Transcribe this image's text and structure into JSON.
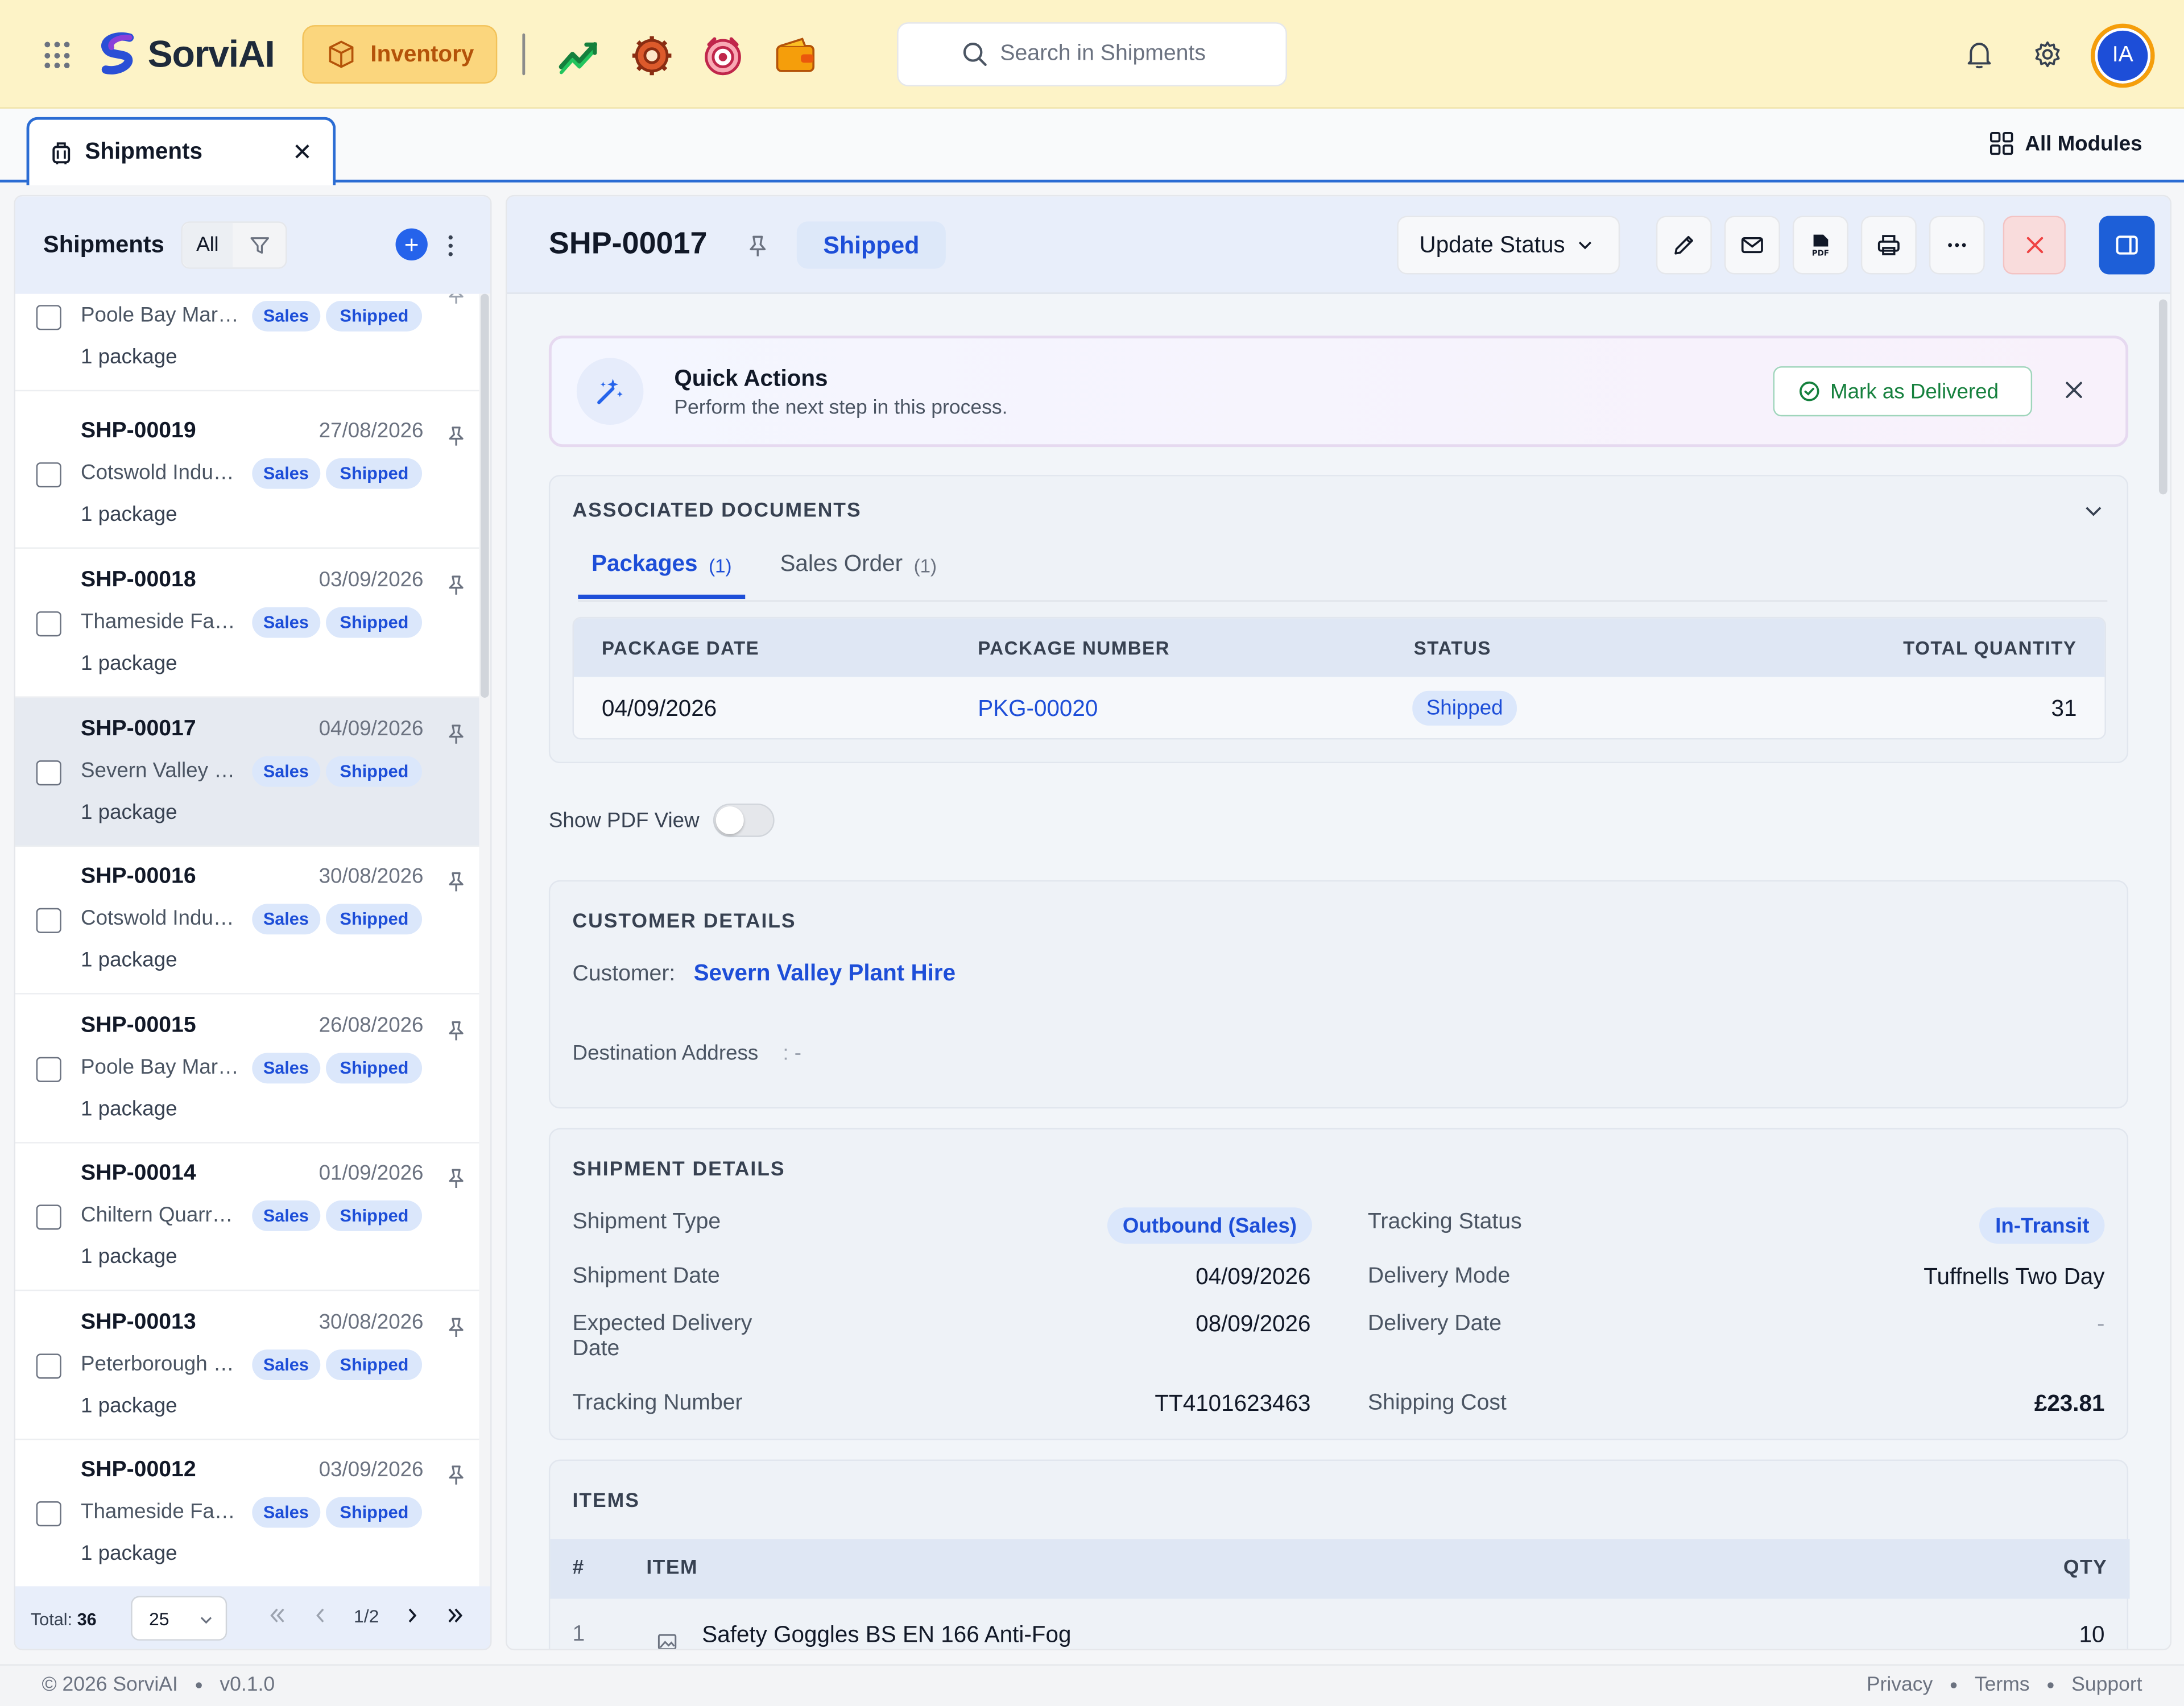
{
  "topbar": {
    "brand": "SorviAI",
    "module": "Inventory",
    "search_placeholder": "Search in Shipments",
    "avatar_initials": "IA",
    "app_icons": [
      "chart-growth-icon",
      "gear-tools-icon",
      "target-icon",
      "wallet-icon"
    ]
  },
  "tabs": {
    "active": "Shipments",
    "all_modules": "All Modules"
  },
  "list": {
    "title": "Shipments",
    "filter_all": "All",
    "rows": [
      {
        "id": "",
        "date": "",
        "customer": "Poole Bay Marine",
        "type": "Sales",
        "status": "Shipped",
        "packages": "1 package"
      },
      {
        "id": "SHP-00019",
        "date": "27/08/2026",
        "customer": "Cotswold Industrial",
        "type": "Sales",
        "status": "Shipped",
        "packages": "1 package"
      },
      {
        "id": "SHP-00018",
        "date": "03/09/2026",
        "customer": "Thameside Fabrication",
        "type": "Sales",
        "status": "Shipped",
        "packages": "1 package"
      },
      {
        "id": "SHP-00017",
        "date": "04/09/2026",
        "customer": "Severn Valley Plant Hire",
        "type": "Sales",
        "status": "Shipped",
        "packages": "1 package",
        "selected": true
      },
      {
        "id": "SHP-00016",
        "date": "30/08/2026",
        "customer": "Cotswold Industrial",
        "type": "Sales",
        "status": "Shipped",
        "packages": "1 package"
      },
      {
        "id": "SHP-00015",
        "date": "26/08/2026",
        "customer": "Poole Bay Marine",
        "type": "Sales",
        "status": "Shipped",
        "packages": "1 package"
      },
      {
        "id": "SHP-00014",
        "date": "01/09/2026",
        "customer": "Chiltern Quarrying",
        "type": "Sales",
        "status": "Shipped",
        "packages": "1 package"
      },
      {
        "id": "SHP-00013",
        "date": "30/08/2026",
        "customer": "Peterborough Supplies",
        "type": "Sales",
        "status": "Shipped",
        "packages": "1 package"
      },
      {
        "id": "SHP-00012",
        "date": "03/09/2026",
        "customer": "Thameside Fabrication",
        "type": "Sales",
        "status": "Shipped",
        "packages": "1 package"
      }
    ],
    "footer": {
      "total_label": "Total:",
      "total": "36",
      "per_page": "25",
      "page": "1/2"
    }
  },
  "detail": {
    "id": "SHP-00017",
    "status": "Shipped",
    "update_status": "Update Status",
    "quick_actions": {
      "title": "Quick Actions",
      "subtitle": "Perform the next step in this process.",
      "button": "Mark as Delivered"
    },
    "associated": {
      "title": "ASSOCIATED DOCUMENTS",
      "tab_packages": "Packages",
      "tab_packages_count": "(1)",
      "tab_sales": "Sales Order",
      "tab_sales_count": "(1)",
      "headers": [
        "PACKAGE DATE",
        "PACKAGE NUMBER",
        "STATUS",
        "TOTAL QUANTITY"
      ],
      "row": {
        "date": "04/09/2026",
        "number": "PKG-00020",
        "status": "Shipped",
        "qty": "31"
      }
    },
    "pdf_toggle": "Show PDF View",
    "customer": {
      "title": "CUSTOMER DETAILS",
      "label": "Customer:",
      "name": "Severn Valley Plant Hire",
      "address_label": "Destination Address",
      "address_value": ": -"
    },
    "shipment": {
      "title": "SHIPMENT DETAILS",
      "type_label": "Shipment Type",
      "type_value": "Outbound (Sales)",
      "date_label": "Shipment Date",
      "date_value": "04/09/2026",
      "expected_label_1": "Expected Delivery",
      "expected_label_2": "Date",
      "expected_value": "08/09/2026",
      "tracking_number_label": "Tracking Number",
      "tracking_number_value": "TT4101623463",
      "tracking_status_label": "Tracking Status",
      "tracking_status_value": "In-Transit",
      "delivery_mode_label": "Delivery Mode",
      "delivery_mode_value": "Tuffnells Two Day",
      "delivery_date_label": "Delivery Date",
      "delivery_date_value": "-",
      "shipping_cost_label": "Shipping Cost",
      "shipping_cost_value": "£23.81"
    },
    "items": {
      "title": "ITEMS",
      "headers": [
        "#",
        "ITEM",
        "QTY"
      ],
      "rows": [
        {
          "n": "1",
          "name": "Safety Goggles BS EN 166 Anti-Fog",
          "qty": "10"
        }
      ]
    }
  },
  "footer": {
    "copyright": "© 2026 SorviAI",
    "version": "v0.1.0",
    "links": [
      "Privacy",
      "Terms",
      "Support"
    ]
  }
}
